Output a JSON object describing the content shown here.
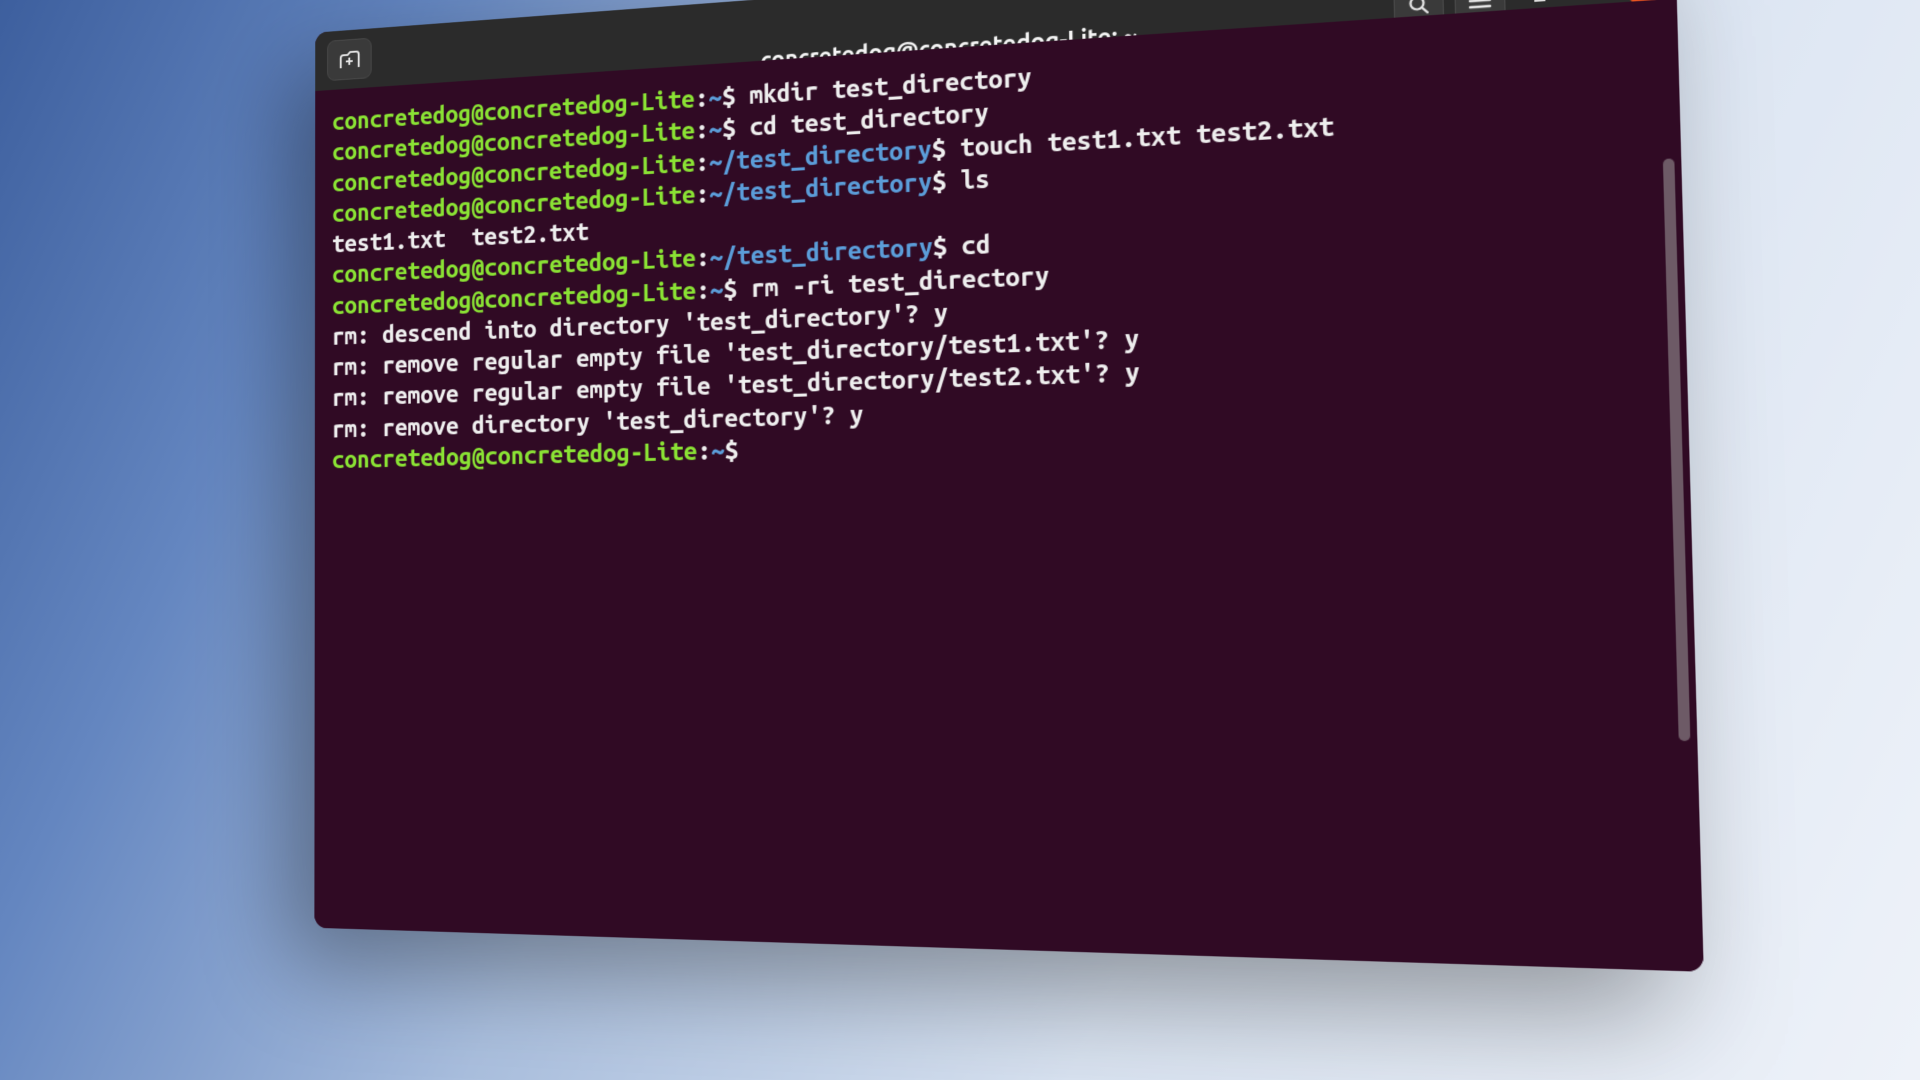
{
  "window": {
    "title": "concretedog@concretedog-Lite: ~",
    "icons": {
      "new_tab": "new-tab-icon",
      "search": "search-icon",
      "menu": "hamburger-icon",
      "minimize": "minimize-icon",
      "maximize": "maximize-icon",
      "close": "close-icon"
    }
  },
  "prompt": {
    "user_host": "concretedog@concretedog-Lite",
    "sep": ":",
    "home": "~",
    "subdir": "~/test_directory",
    "dollar": "$"
  },
  "lines": [
    {
      "path": "home",
      "cmd": "mkdir test_directory"
    },
    {
      "path": "home",
      "cmd": "cd test_directory"
    },
    {
      "path": "subdir",
      "cmd": "touch test1.txt test2.txt"
    },
    {
      "path": "subdir",
      "cmd": "ls"
    },
    {
      "out": "test1.txt  test2.txt"
    },
    {
      "path": "subdir",
      "cmd": "cd"
    },
    {
      "path": "home",
      "cmd": "rm -ri test_directory"
    },
    {
      "out": "rm: descend into directory 'test_directory'? y"
    },
    {
      "out": "rm: remove regular empty file 'test_directory/test1.txt'? y"
    },
    {
      "out": "rm: remove regular empty file 'test_directory/test2.txt'? y"
    },
    {
      "out": "rm: remove directory 'test_directory'? y"
    },
    {
      "path": "home",
      "cmd": ""
    }
  ]
}
